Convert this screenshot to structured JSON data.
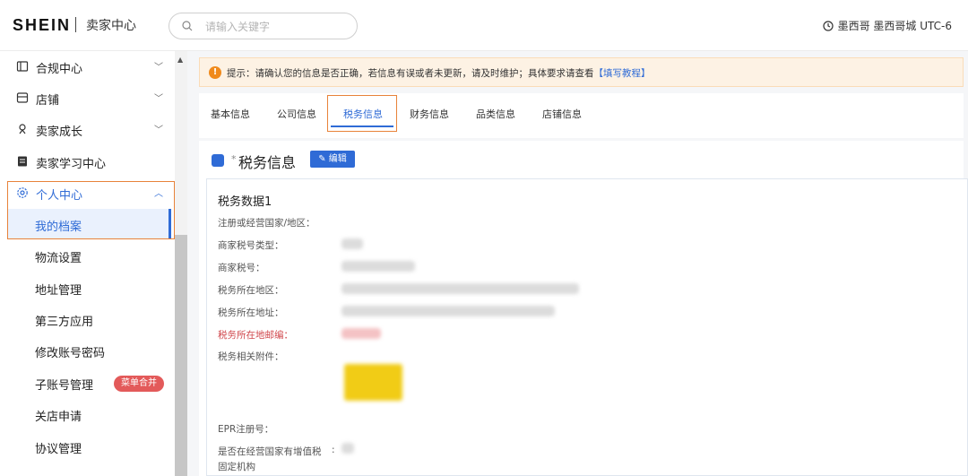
{
  "header": {
    "logo": "SHEIN",
    "title": "卖家中心",
    "search_placeholder": "请输入关键字",
    "timezone": "墨西哥 墨西哥城 UTC-6"
  },
  "sidebar": {
    "items": [
      {
        "label": "合规中心",
        "icon": "compliance-icon",
        "expandable": true
      },
      {
        "label": "店铺",
        "icon": "shop-icon",
        "expandable": true
      },
      {
        "label": "卖家成长",
        "icon": "growth-icon",
        "expandable": true
      },
      {
        "label": "卖家学习中心",
        "icon": "book-icon",
        "expandable": false
      },
      {
        "label": "个人中心",
        "icon": "gear-icon",
        "expandable": true,
        "expanded": true
      }
    ],
    "sub_items": [
      {
        "label": "我的档案",
        "active": true
      },
      {
        "label": "物流设置"
      },
      {
        "label": "地址管理"
      },
      {
        "label": "第三方应用"
      },
      {
        "label": "修改账号密码"
      },
      {
        "label": "子账号管理"
      },
      {
        "label": "关店申请"
      },
      {
        "label": "协议管理"
      }
    ],
    "badge": "菜单合并"
  },
  "notice": {
    "text": "提示：请确认您的信息是否正确，若信息有误或者未更新，请及时维护；具体要求请查看",
    "link": "【填写教程】"
  },
  "tabs": [
    {
      "label": "基本信息"
    },
    {
      "label": "公司信息"
    },
    {
      "label": "税务信息",
      "active": true
    },
    {
      "label": "财务信息"
    },
    {
      "label": "品类信息"
    },
    {
      "label": "店铺信息"
    }
  ],
  "section": {
    "title": "税务信息",
    "edit_label": "编辑",
    "data_title": "税务数据1",
    "fields": [
      {
        "label": "注册或经营国家/地区："
      },
      {
        "label": "商家税号类型："
      },
      {
        "label": "商家税号："
      },
      {
        "label": "税务所在地区："
      },
      {
        "label": "税务所在地址："
      },
      {
        "label": "税务所在地邮编："
      },
      {
        "label": "税务相关附件："
      },
      {
        "label": "EPR注册号："
      },
      {
        "label": "是否在经营国家有增值税"
      },
      {
        "label": "固定机构"
      }
    ]
  },
  "colors": {
    "accent": "#2f6bd6",
    "highlight": "#e8833a",
    "badge": "#e35a5a",
    "notice_bg": "#fdf2e4"
  }
}
